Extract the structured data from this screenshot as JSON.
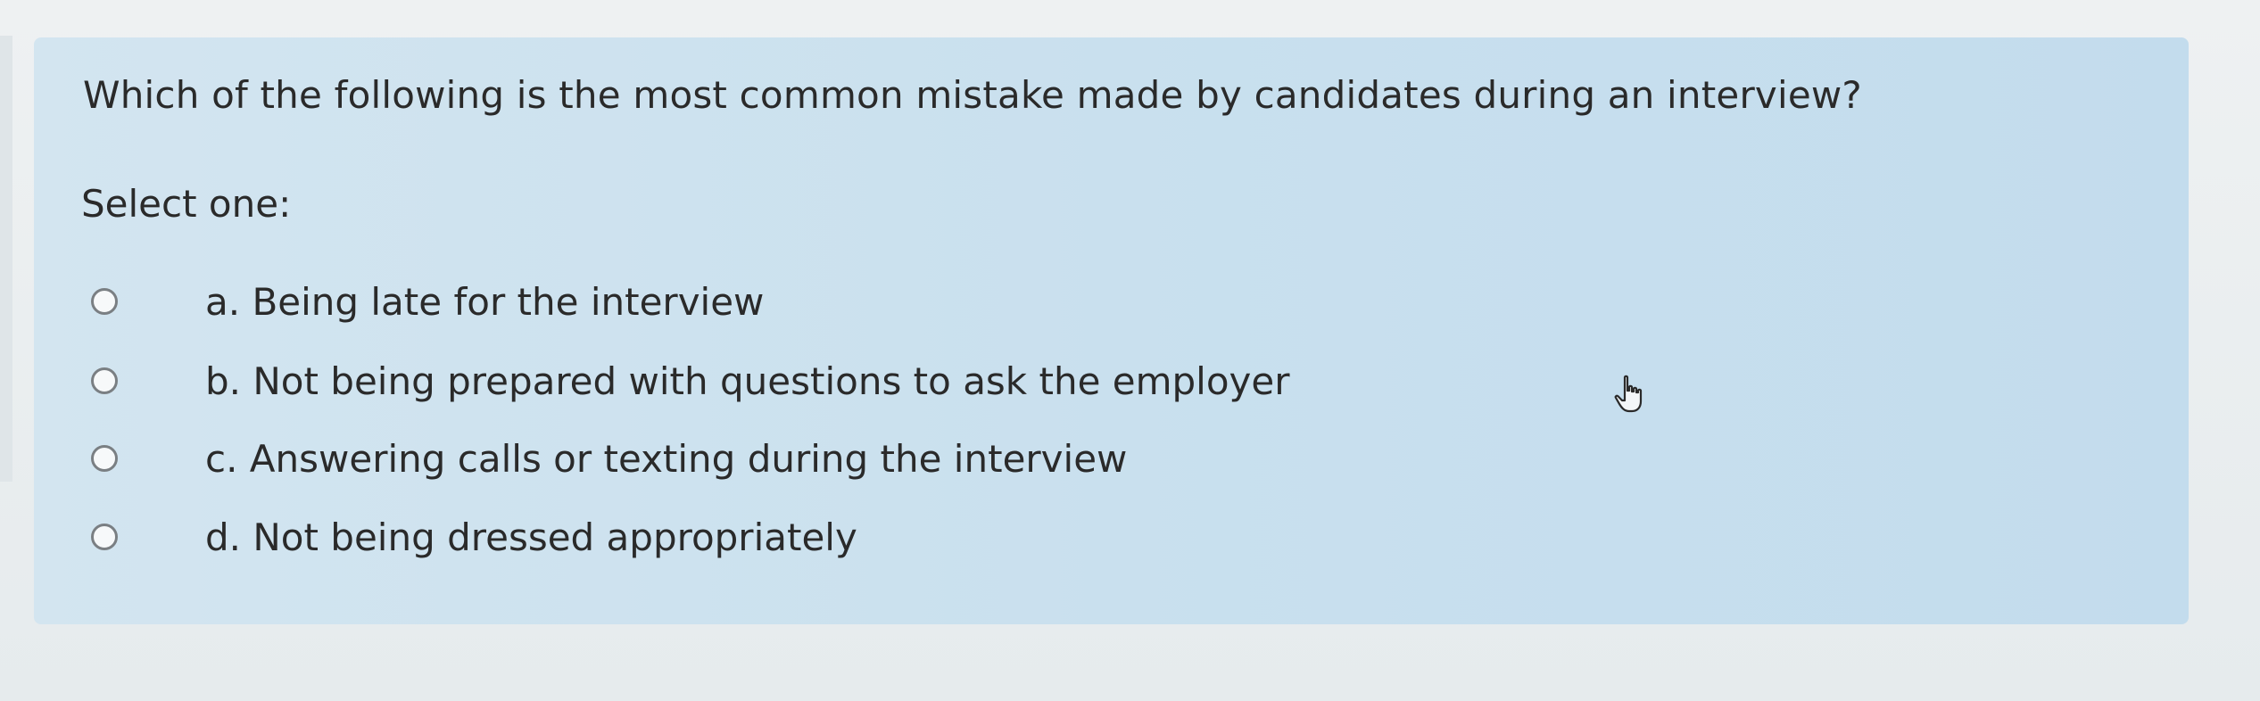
{
  "question": {
    "text": "Which of the following is the most common mistake made by candidates during an interview?",
    "prompt": "Select one:",
    "options": [
      {
        "label": "a. Being late for the interview",
        "selected": false
      },
      {
        "label": "b. Not being prepared with questions to ask the employer",
        "selected": false
      },
      {
        "label": "c. Answering calls or texting during the interview",
        "selected": false
      },
      {
        "label": "d. Not being dressed appropriately",
        "selected": false
      }
    ]
  },
  "icons": {
    "cursor": "hand-pointer-icon"
  }
}
